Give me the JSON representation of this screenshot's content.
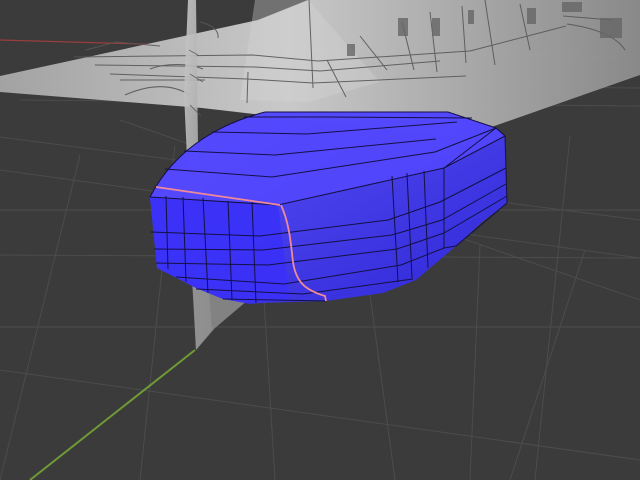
{
  "app": {
    "title": ""
  },
  "viewport": {
    "overlay_lines": []
  },
  "colors": {
    "background": "#3b3b3b",
    "grid_line": "#4d4d4d",
    "grid_line_dark": "#343434",
    "x_axis": "#9b3d3d",
    "y_axis": "#6f9a35",
    "mesh_fill": "#3a31f3",
    "mesh_fill_alt": "#4338ff",
    "mesh_edge": "#141044",
    "seam": "#f08a9b",
    "blueprint_bg": "#b8b8b8",
    "blueprint_line": "#555555",
    "blueprint_plane": "#8f8f8f"
  },
  "icons": {
    "viewport": "3d-viewport-icon",
    "grid": "grid-icon",
    "mesh": "mesh-object-icon",
    "reference": "reference-image-icon"
  }
}
